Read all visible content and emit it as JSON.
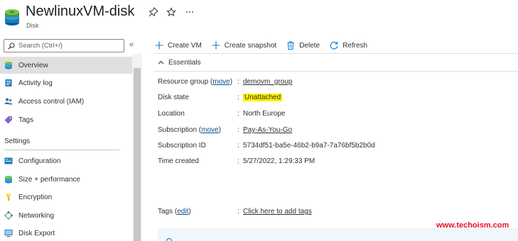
{
  "header": {
    "title": "NewlinuxVM-disk",
    "subtitle": "Disk",
    "icons": [
      "disk-icon",
      "pin-icon",
      "star-icon",
      "more-icon"
    ]
  },
  "sidebar": {
    "search_placeholder": "Search (Ctrl+/)",
    "collapse_label": "«",
    "items": [
      {
        "label": "Overview",
        "icon": "disk-icon",
        "active": true
      },
      {
        "label": "Activity log",
        "icon": "activity-log-icon"
      },
      {
        "label": "Access control (IAM)",
        "icon": "people-icon"
      },
      {
        "label": "Tags",
        "icon": "tag-icon"
      }
    ],
    "settings_heading": "Settings",
    "settings_items": [
      {
        "label": "Configuration",
        "icon": "configuration-icon"
      },
      {
        "label": "Size + performance",
        "icon": "disk-size-icon"
      },
      {
        "label": "Encryption",
        "icon": "key-icon"
      },
      {
        "label": "Networking",
        "icon": "network-icon"
      },
      {
        "label": "Disk Export",
        "icon": "export-icon"
      }
    ]
  },
  "toolbar": {
    "create_vm": "Create VM",
    "create_snapshot": "Create snapshot",
    "delete": "Delete",
    "refresh": "Refresh"
  },
  "essentials": {
    "heading": "Essentials",
    "resource_group": {
      "label": "Resource group",
      "move_link": "move",
      "value": "demovm_group"
    },
    "disk_state": {
      "label": "Disk state",
      "value": "Unattached"
    },
    "location": {
      "label": "Location",
      "value": "North Europe"
    },
    "subscription": {
      "label": "Subscription",
      "move_link": "move",
      "value": "Pay-As-You-Go"
    },
    "subscription_id": {
      "label": "Subscription ID",
      "value": "5734df51-ba5e-46b2-b9a7-7a76bf5b2b0d"
    },
    "time_created": {
      "label": "Time created",
      "value": "5/27/2022, 1:29:33 PM"
    },
    "tags": {
      "label": "Tags",
      "edit_link": "edit",
      "value": "Click here to add tags"
    }
  },
  "watermark": "www.techoism.com",
  "colors": {
    "accent": "#0078d4",
    "highlight": "#fff100",
    "link": "#0f4b8f",
    "watermark": "#e81123"
  }
}
